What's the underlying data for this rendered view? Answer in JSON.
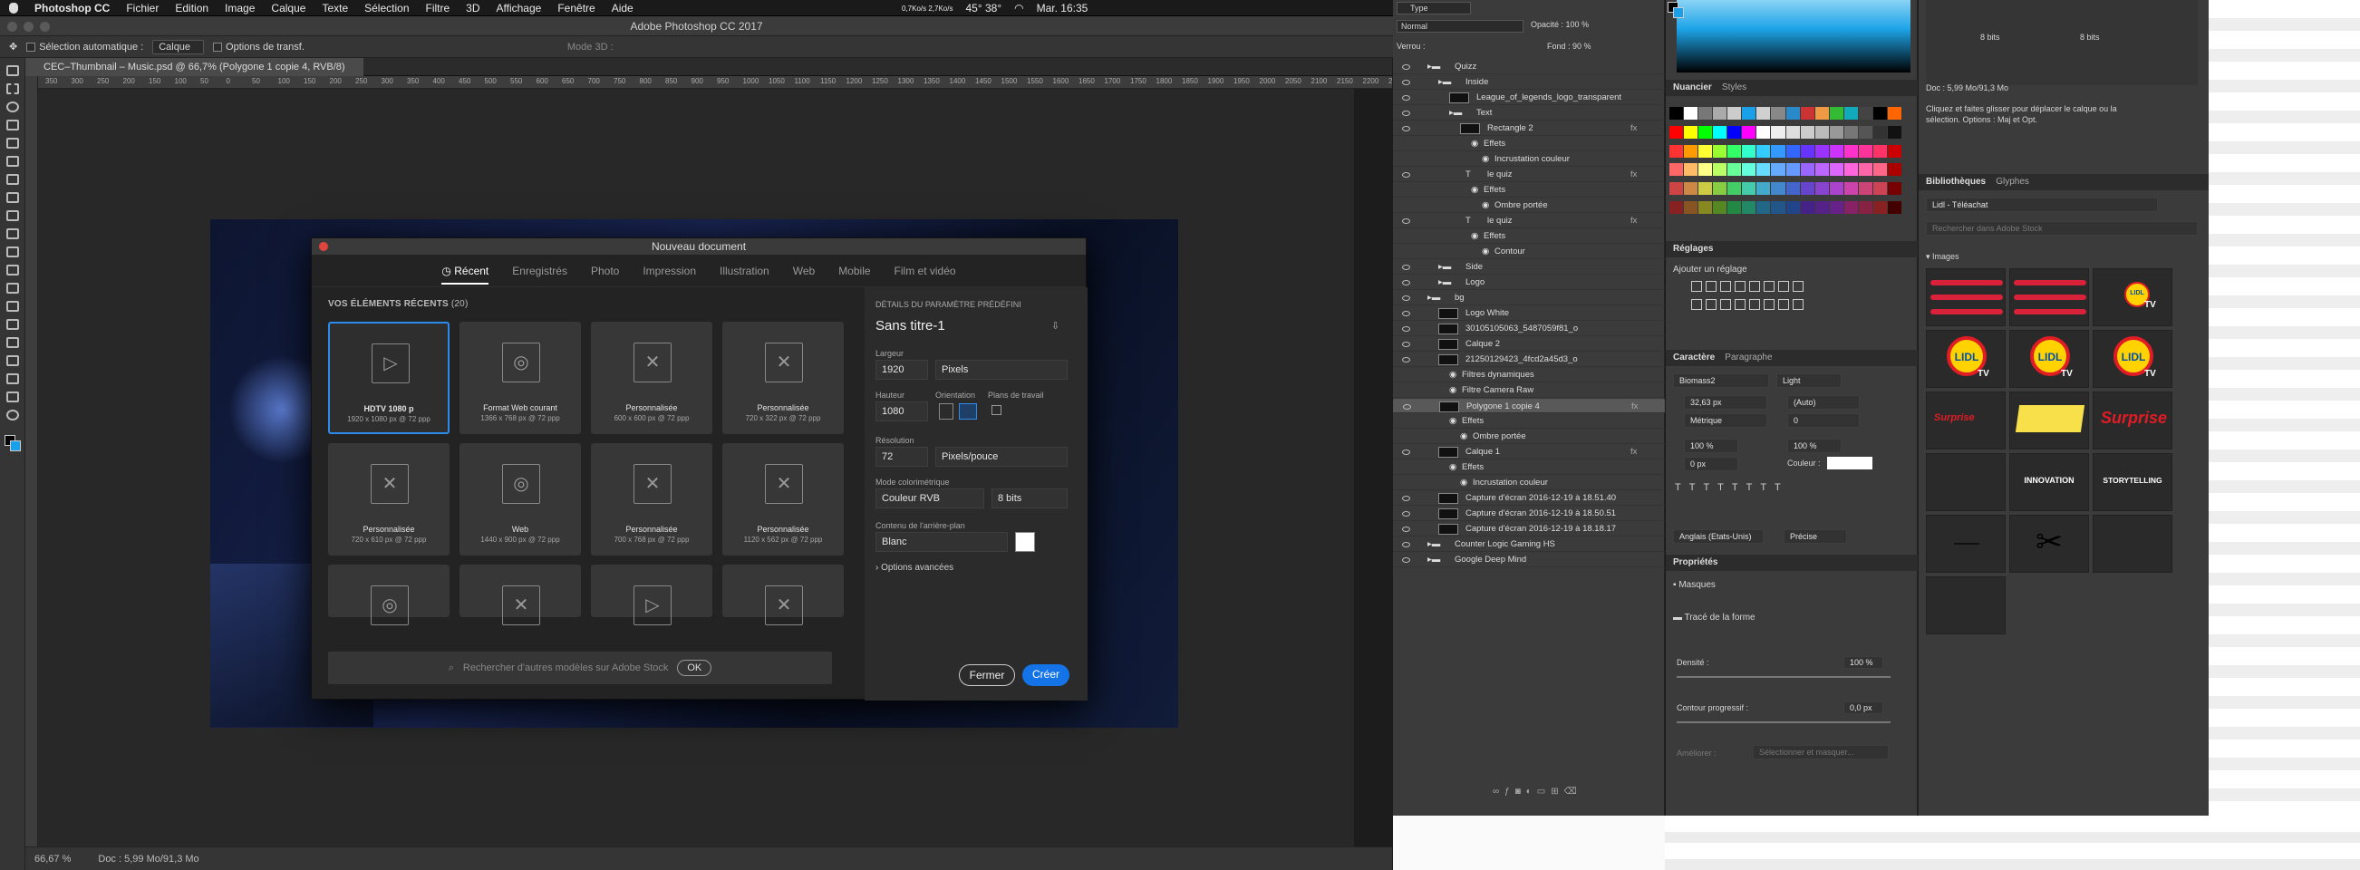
{
  "menubar": {
    "app": "Photoshop CC",
    "items": [
      "Fichier",
      "Edition",
      "Image",
      "Calque",
      "Texte",
      "Sélection",
      "Filtre",
      "3D",
      "Affichage",
      "Fenêtre",
      "Aide"
    ],
    "status": {
      "speed": "0,7Ko/s 2,7Ko/s",
      "temp": "45° 38°",
      "clock": "Mar. 16:35"
    }
  },
  "window_title": "Adobe Photoshop CC 2017",
  "options": {
    "auto_select": "Sélection automatique :",
    "auto_select_value": "Calque",
    "transform": "Options de transf.",
    "mode3d": "Mode 3D :"
  },
  "doc_tab": "CEC–Thumbnail – Music.psd @ 66,7% (Polygone 1 copie 4, RVB/8)",
  "ruler": [
    "350",
    "300",
    "250",
    "200",
    "150",
    "100",
    "50",
    "0",
    "50",
    "100",
    "150",
    "200",
    "250",
    "300",
    "350",
    "400",
    "450",
    "500",
    "550",
    "600",
    "650",
    "700",
    "750",
    "800",
    "850",
    "900",
    "950",
    "1000",
    "1050",
    "1100",
    "1150",
    "1200",
    "1250",
    "1300",
    "1350",
    "1400",
    "1450",
    "1500",
    "1550",
    "1600",
    "1650",
    "1700",
    "1750",
    "1800",
    "1850",
    "1900",
    "1950",
    "2000",
    "2050",
    "2100",
    "2150",
    "2200",
    "2250"
  ],
  "status": {
    "zoom": "66,67 %",
    "doc": "Doc : 5,99 Mo/91,3 Mo"
  },
  "dialog": {
    "title": "Nouveau document",
    "tabs": [
      "Récent",
      "Enregistrés",
      "Photo",
      "Impression",
      "Illustration",
      "Web",
      "Mobile",
      "Film et vidéo"
    ],
    "section": "VOS ÉLÉMENTS RÉCENTS",
    "section_count": "(20)",
    "presets": [
      {
        "name": "HDTV 1080 p",
        "desc": "1920 x 1080 px @ 72 ppp",
        "icon": "▷"
      },
      {
        "name": "Format Web courant",
        "desc": "1366 x 768 px @ 72 ppp",
        "icon": "◎"
      },
      {
        "name": "Personnalisée",
        "desc": "600 x 600 px @ 72 ppp",
        "icon": "✕"
      },
      {
        "name": "Personnalisée",
        "desc": "720 x 322 px @ 72 ppp",
        "icon": "✕"
      },
      {
        "name": "Personnalisée",
        "desc": "720 x 610 px @ 72 ppp",
        "icon": "✕"
      },
      {
        "name": "Web",
        "desc": "1440 x 900 px @ 72 ppp",
        "icon": "◎"
      },
      {
        "name": "Personnalisée",
        "desc": "700 x 768 px @ 72 ppp",
        "icon": "✕"
      },
      {
        "name": "Personnalisée",
        "desc": "1120 x 562 px @ 72 ppp",
        "icon": "✕"
      },
      {
        "name": "",
        "desc": "",
        "icon": "◎"
      },
      {
        "name": "",
        "desc": "",
        "icon": "✕"
      },
      {
        "name": "",
        "desc": "",
        "icon": "▷"
      },
      {
        "name": "",
        "desc": "",
        "icon": "✕"
      }
    ],
    "search_placeholder": "Rechercher d'autres modèles sur Adobe Stock",
    "ok": "OK",
    "details_head": "DÉTAILS DU PARAMÈTRE PRÉDÉFINI",
    "doc_name": "Sans titre-1",
    "width_label": "Largeur",
    "width": "1920",
    "unit": "Pixels",
    "height_label": "Hauteur",
    "height": "1080",
    "orientation_label": "Orientation",
    "artboards_label": "Plans de travail",
    "resolution_label": "Résolution",
    "resolution": "72",
    "res_unit": "Pixels/pouce",
    "color_mode_label": "Mode colorimétrique",
    "color_mode": "Couleur RVB",
    "bits": "8 bits",
    "bg_label": "Contenu de l'arrière-plan",
    "bg": "Blanc",
    "advanced": "Options avancées",
    "close": "Fermer",
    "create": "Créer"
  },
  "layers": {
    "filter": "Type",
    "blend": "Normal",
    "opacity_label": "Opacité :",
    "opacity": "100 %",
    "lock": "Verrou :",
    "fill_label": "Fond :",
    "fill": "90 %",
    "rows": [
      {
        "name": "Quizz",
        "indent": 1,
        "kind": "folder"
      },
      {
        "name": "Inside",
        "indent": 2,
        "kind": "folder"
      },
      {
        "name": "League_of_legends_logo_transparent",
        "indent": 3,
        "kind": "img"
      },
      {
        "name": "Text",
        "indent": 3,
        "kind": "folder"
      },
      {
        "name": "Rectangle 2",
        "indent": 4,
        "kind": "img",
        "fx": true
      },
      {
        "name": "Effets",
        "indent": 5,
        "kind": "sub"
      },
      {
        "name": "Incrustation couleur",
        "indent": 6,
        "kind": "sub"
      },
      {
        "name": "le quiz",
        "indent": 4,
        "kind": "text",
        "fx": true
      },
      {
        "name": "Effets",
        "indent": 5,
        "kind": "sub"
      },
      {
        "name": "Ombre portée",
        "indent": 6,
        "kind": "sub"
      },
      {
        "name": "le quiz",
        "indent": 4,
        "kind": "text",
        "fx": true
      },
      {
        "name": "Effets",
        "indent": 5,
        "kind": "sub"
      },
      {
        "name": "Contour",
        "indent": 6,
        "kind": "sub"
      },
      {
        "name": "Side",
        "indent": 2,
        "kind": "folder"
      },
      {
        "name": "Logo",
        "indent": 2,
        "kind": "folder"
      },
      {
        "name": "bg",
        "indent": 1,
        "kind": "folder"
      },
      {
        "name": "Logo White",
        "indent": 2,
        "kind": "img"
      },
      {
        "name": "30105105063_5487059f81_o",
        "indent": 2,
        "kind": "img"
      },
      {
        "name": "Calque 2",
        "indent": 2,
        "kind": "img"
      },
      {
        "name": "21250129423_4fcd2a45d3_o",
        "indent": 2,
        "kind": "img"
      },
      {
        "name": "Filtres dynamiques",
        "indent": 3,
        "kind": "sub"
      },
      {
        "name": "Filtre Camera Raw",
        "indent": 3,
        "kind": "sub"
      },
      {
        "name": "Polygone 1 copie 4",
        "indent": 2,
        "kind": "img",
        "fx": true,
        "selected": true
      },
      {
        "name": "Effets",
        "indent": 3,
        "kind": "sub"
      },
      {
        "name": "Ombre portée",
        "indent": 4,
        "kind": "sub"
      },
      {
        "name": "Calque 1",
        "indent": 2,
        "kind": "img",
        "fx": true
      },
      {
        "name": "Effets",
        "indent": 3,
        "kind": "sub"
      },
      {
        "name": "Incrustation couleur",
        "indent": 4,
        "kind": "sub"
      },
      {
        "name": "Capture d'écran 2016-12-19 à 18.51.40",
        "indent": 2,
        "kind": "img"
      },
      {
        "name": "Capture d'écran 2016-12-19 à 18.50.51",
        "indent": 2,
        "kind": "img"
      },
      {
        "name": "Capture d'écran 2016-12-19 à 18.18.17",
        "indent": 2,
        "kind": "img"
      },
      {
        "name": "Counter Logic Gaming HS",
        "indent": 1,
        "kind": "folder"
      },
      {
        "name": "Google Deep Mind",
        "indent": 1,
        "kind": "folder"
      }
    ]
  },
  "mid": {
    "swatches_tab": "Nuancier",
    "styles_tab": "Styles",
    "adjust": "Réglages",
    "adjust_add": "Ajouter un réglage",
    "char_tab": "Caractère",
    "para_tab": "Paragraphe",
    "font": "Biomass2",
    "style": "Light",
    "size": "32,63 px",
    "leading": "(Auto)",
    "kern": "Métrique",
    "track": "0",
    "vscale": "100 %",
    "hscale": "100 %",
    "baseline": "0 px",
    "color_label": "Couleur :",
    "lang": "Anglais (Etats-Unis)",
    "aa": "Précise",
    "props": "Propriétés",
    "masks": "Masques",
    "shape": "Tracé de la forme",
    "density_label": "Densité :",
    "density": "100 %",
    "feather_label": "Contour progressif :",
    "feather": "0,0 px",
    "refine": "Améliorer :",
    "select_mask": "Sélectionner et masquer..."
  },
  "info": {
    "bits1": "8 bits",
    "bits2": "8 bits",
    "doc": "Doc : 5,99 Mo/91,3 Mo",
    "hint": "Cliquez et faites glisser pour déplacer le calque ou la sélection. Options : Maj et Opt."
  },
  "library": {
    "tab1": "Bibliothèques",
    "tab2": "Glyphes",
    "name": "Lidl - Téléachat",
    "search": "Rechercher dans Adobe Stock",
    "section": "Images",
    "texts": {
      "lidl": "LIDL",
      "tv": "TV",
      "surprise": "Surprise",
      "innovation": "INNOVATION",
      "storytelling": "STORYTELLING"
    }
  },
  "colors": {
    "accent": "#2d8ceb",
    "selection": "#595959",
    "lidl_yellow": "#ffd200",
    "lidl_red": "#e01c25",
    "lidl_blue": "#0050aa"
  }
}
